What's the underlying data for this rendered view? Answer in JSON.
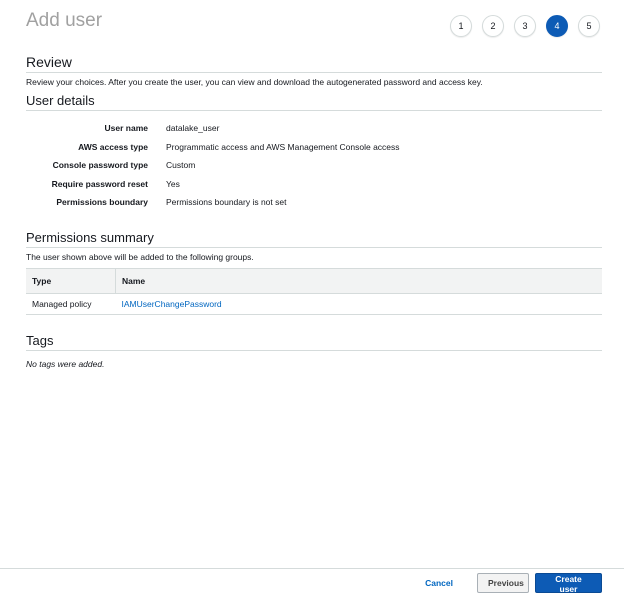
{
  "header": {
    "title": "Add user",
    "steps": [
      {
        "label": "1",
        "active": false
      },
      {
        "label": "2",
        "active": false
      },
      {
        "label": "3",
        "active": false
      },
      {
        "label": "4",
        "active": true
      },
      {
        "label": "5",
        "active": false
      }
    ]
  },
  "review": {
    "heading": "Review",
    "description": "Review your choices. After you create the user, you can view and download the autogenerated password and access key."
  },
  "user_details": {
    "heading": "User details",
    "rows": [
      {
        "label": "User name",
        "value": "datalake_user"
      },
      {
        "label": "AWS access type",
        "value": "Programmatic access and AWS Management Console access"
      },
      {
        "label": "Console password type",
        "value": "Custom"
      },
      {
        "label": "Require password reset",
        "value": "Yes"
      },
      {
        "label": "Permissions boundary",
        "value": "Permissions boundary is not set"
      }
    ]
  },
  "permissions": {
    "heading": "Permissions summary",
    "description": "The user shown above will be added to the following groups.",
    "columns": [
      "Type",
      "Name"
    ],
    "rows": [
      {
        "type": "Managed policy",
        "name": "IAMUserChangePassword"
      }
    ]
  },
  "tags": {
    "heading": "Tags",
    "empty_text": "No tags were added."
  },
  "footer": {
    "cancel_label": "Cancel",
    "previous_label": "Previous",
    "create_label": "Create user"
  },
  "colors": {
    "accent": "#0d5bb5",
    "link": "#0066c0",
    "title_gray": "#a1a1a1"
  }
}
